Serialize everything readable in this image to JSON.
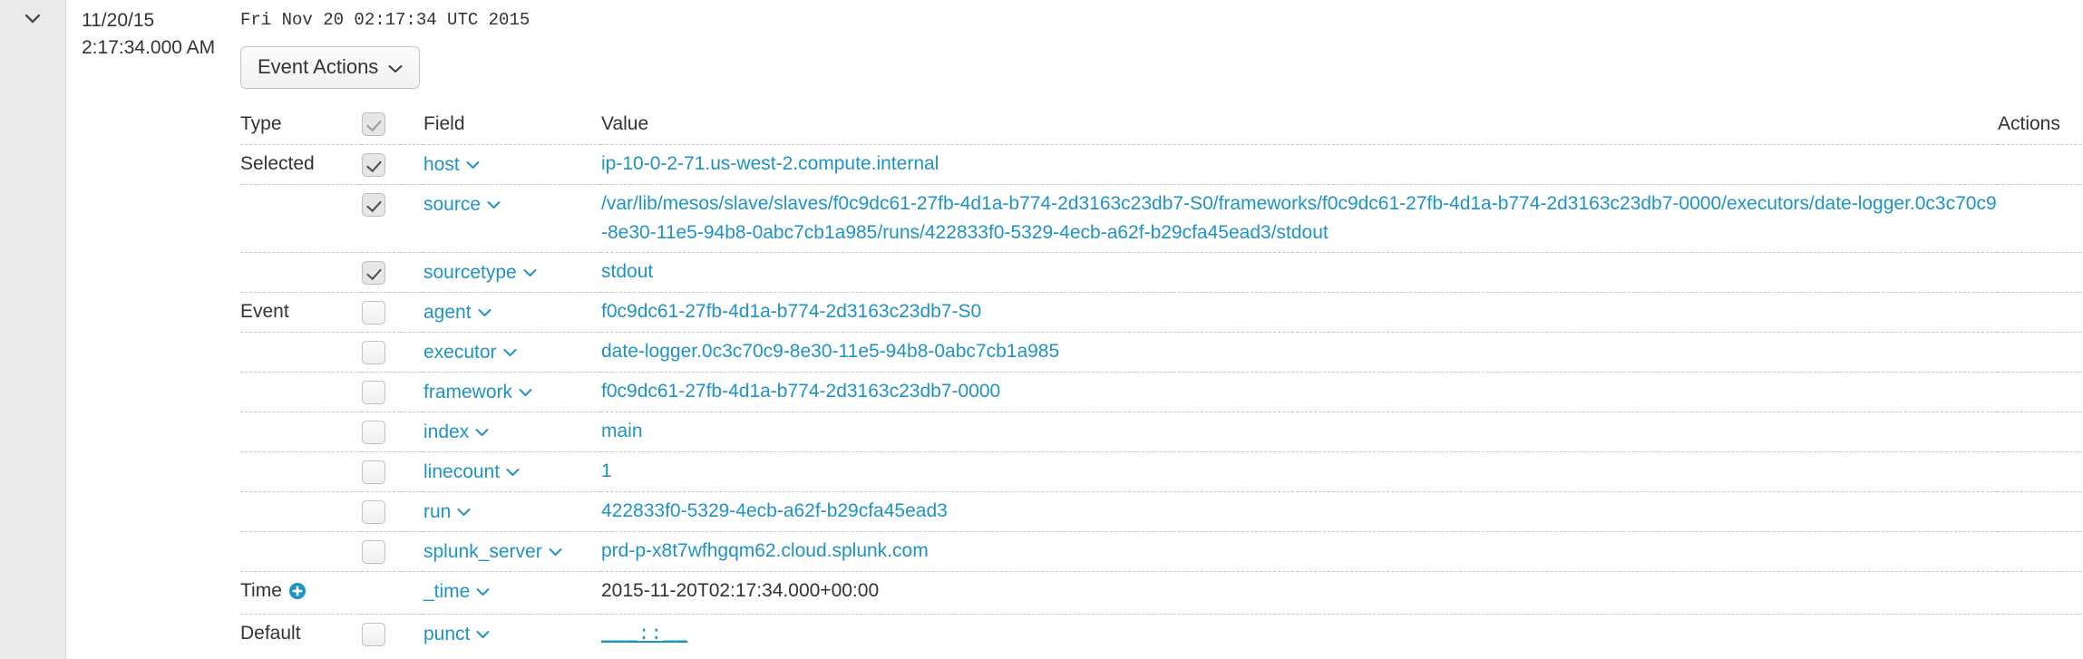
{
  "colors": {
    "link": "#1e93c6",
    "text": "#333333",
    "gutter_bg": "#eaeaea",
    "row_divider": "#c6c6c6",
    "time_plus": "#1e93c6"
  },
  "gutter": {
    "expand_icon": "chevron-down-icon"
  },
  "timestamp": {
    "date": "11/20/15",
    "time": "2:17:34.000 AM"
  },
  "raw_event": "Fri Nov 20 02:17:34 UTC 2015",
  "toolbar": {
    "event_actions_label": "Event Actions",
    "event_actions_caret": "chevron-down-icon"
  },
  "table": {
    "headers": {
      "type": "Type",
      "field": "Field",
      "value": "Value",
      "actions": "Actions"
    },
    "header_checkbox_checked": true,
    "rows": [
      {
        "type": "Selected",
        "checkbox": "checked",
        "field": "host",
        "value": "ip-10-0-2-71.us-west-2.compute.internal",
        "value_kind": "link",
        "actions_icon": "chevron-down-icon"
      },
      {
        "type": "",
        "checkbox": "checked",
        "field": "source",
        "value": "/var/lib/mesos/slave/slaves/f0c9dc61-27fb-4d1a-b774-2d3163c23db7-S0/frameworks/f0c9dc61-27fb-4d1a-b774-2d3163c23db7-0000/executors/date-logger.0c3c70c9-8e30-11e5-94b8-0abc7cb1a985/runs/422833f0-5329-4ecb-a62f-b29cfa45ead3/stdout",
        "value_kind": "link",
        "actions_icon": "chevron-down-icon"
      },
      {
        "type": "",
        "checkbox": "checked",
        "field": "sourcetype",
        "value": "stdout",
        "value_kind": "link",
        "actions_icon": "chevron-down-icon"
      },
      {
        "type": "Event",
        "checkbox": "unchecked",
        "field": "agent",
        "value": "f0c9dc61-27fb-4d1a-b774-2d3163c23db7-S0",
        "value_kind": "link",
        "actions_icon": "chevron-down-icon"
      },
      {
        "type": "",
        "checkbox": "unchecked",
        "field": "executor",
        "value": "date-logger.0c3c70c9-8e30-11e5-94b8-0abc7cb1a985",
        "value_kind": "link",
        "actions_icon": "chevron-down-icon"
      },
      {
        "type": "",
        "checkbox": "unchecked",
        "field": "framework",
        "value": "f0c9dc61-27fb-4d1a-b774-2d3163c23db7-0000",
        "value_kind": "link",
        "actions_icon": "chevron-down-icon"
      },
      {
        "type": "",
        "checkbox": "unchecked",
        "field": "index",
        "value": "main",
        "value_kind": "link",
        "actions_icon": "chevron-down-icon"
      },
      {
        "type": "",
        "checkbox": "unchecked",
        "field": "linecount",
        "value": "1",
        "value_kind": "link",
        "actions_icon": "chevron-down-icon"
      },
      {
        "type": "",
        "checkbox": "unchecked",
        "field": "run",
        "value": "422833f0-5329-4ecb-a62f-b29cfa45ead3",
        "value_kind": "link",
        "actions_icon": "chevron-down-icon"
      },
      {
        "type": "",
        "checkbox": "unchecked",
        "field": "splunk_server",
        "value": "prd-p-x8t7wfhgqm62.cloud.splunk.com",
        "value_kind": "link",
        "actions_icon": "chevron-down-icon"
      },
      {
        "type": "Time",
        "type_icon": "plus-circle-icon",
        "checkbox": "none",
        "field": "_time",
        "value": "2015-11-20T02:17:34.000+00:00",
        "value_kind": "plain",
        "actions_icon": "none"
      },
      {
        "type": "Default",
        "checkbox": "unchecked",
        "field": "punct",
        "value": "___::__",
        "value_kind": "punct",
        "actions_icon": "chevron-down-icon"
      }
    ]
  }
}
